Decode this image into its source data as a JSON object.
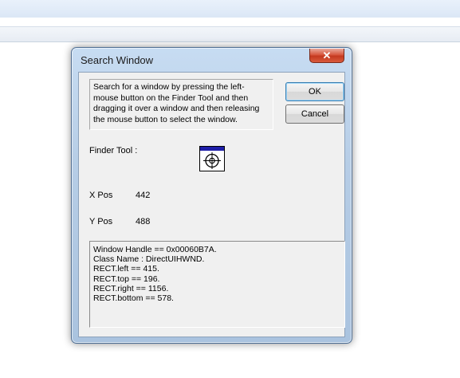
{
  "dialog": {
    "title": "Search Window",
    "close_glyph": "✕",
    "instructions": "Search for a window by pressing the left-mouse button on the Finder Tool and then dragging it over a window and then releasing the mouse button to select the window.",
    "ok_label": "OK",
    "cancel_label": "Cancel",
    "finder_label": "Finder Tool :",
    "finder_icon": "crosshair-icon",
    "xpos_label": "X Pos",
    "xpos_value": "442",
    "ypos_label": "Y Pos",
    "ypos_value": "488",
    "output_lines": [
      "Window Handle == 0x00060B7A.",
      "Class Name : DirectUIHWND.",
      "RECT.left == 415.",
      "RECT.top == 196.",
      "RECT.right == 1156.",
      "RECT.bottom == 578."
    ]
  },
  "colors": {
    "finder_bar": "#1e1ea8",
    "close_button": "#c4391f",
    "frame": "#b6cde6"
  }
}
